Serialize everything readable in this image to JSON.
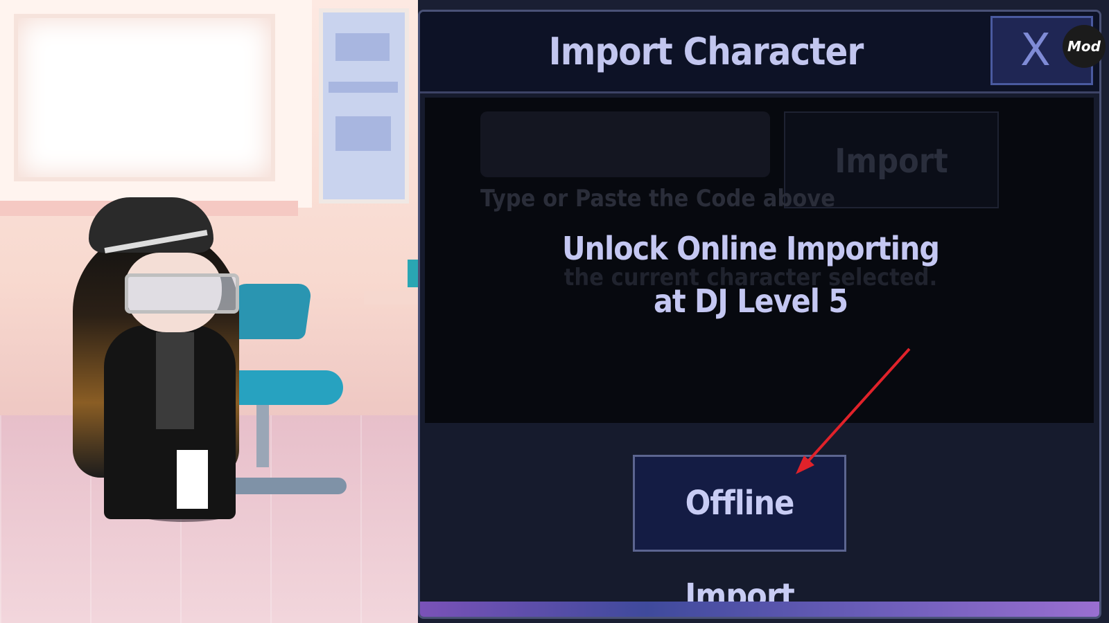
{
  "dialog": {
    "title": "Import Character",
    "close_label": "X",
    "code_input": {
      "value": "",
      "placeholder": ""
    },
    "hint": "Type or Paste the Code above",
    "import_button": "Import",
    "faded_description": "the current character selected.",
    "unlock_message_line1": "Unlock Online Importing",
    "unlock_message_line2": "at DJ Level 5",
    "offline_import_button": "Offline Import"
  },
  "overlay": {
    "mod_badge": "Mod"
  },
  "annotation": {
    "arrow_color": "#e0222a"
  },
  "colors": {
    "dialog_bg": "#161b2d",
    "accent_text": "#c2c6ef",
    "button_bg": "#141c44"
  }
}
